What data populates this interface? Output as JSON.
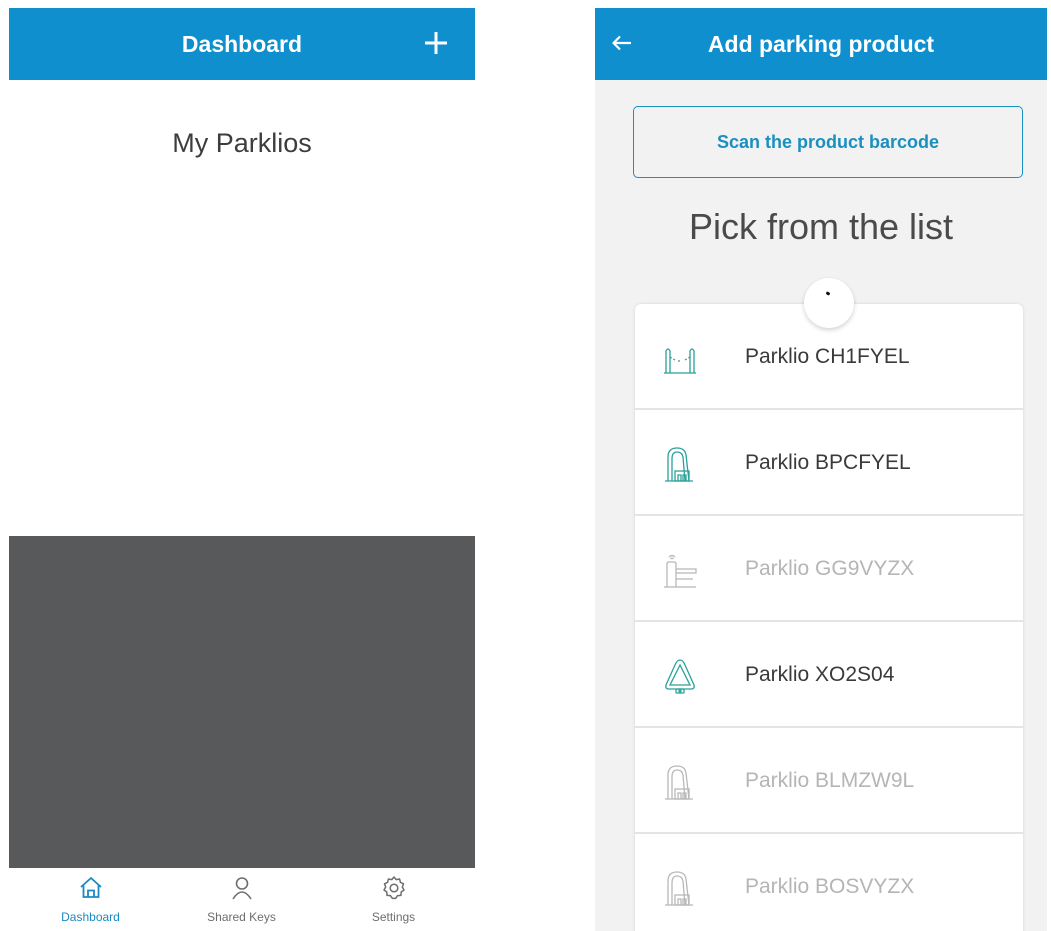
{
  "left_screen": {
    "header": {
      "title": "Dashboard",
      "add_icon": "plus-icon"
    },
    "content": {
      "heading": "My Parklios"
    },
    "bottom_nav": [
      {
        "label": "Dashboard",
        "icon": "home-icon",
        "active": true
      },
      {
        "label": "Shared Keys",
        "icon": "person-icon",
        "active": false
      },
      {
        "label": "Settings",
        "icon": "gear-icon",
        "active": false
      }
    ]
  },
  "right_screen": {
    "header": {
      "title": "Add parking product",
      "back_icon": "arrow-left-icon"
    },
    "scan_button": {
      "label": "Scan the product barcode"
    },
    "pick_heading": "Pick from the list",
    "products": [
      {
        "label": "Parklio CH1FYEL",
        "icon": "chain-barrier-icon",
        "enabled": true
      },
      {
        "label": "Parklio BPCFYEL",
        "icon": "parking-barrier-icon",
        "enabled": true
      },
      {
        "label": "Parklio GG9VYZX",
        "icon": "gate-barrier-icon",
        "enabled": false
      },
      {
        "label": "Parklio XO2S04",
        "icon": "triangle-lock-icon",
        "enabled": true
      },
      {
        "label": "Parklio BLMZW9L",
        "icon": "parking-barrier-icon",
        "enabled": false
      },
      {
        "label": "Parklio BOSVYZX",
        "icon": "parking-barrier-icon",
        "enabled": false
      }
    ]
  },
  "colors": {
    "primary": "#0f8fce",
    "accent_text": "#1b8fbf",
    "icon_teal": "#2aa198",
    "dark_panel": "#58595b",
    "disabled_text": "#b5b5b5"
  }
}
